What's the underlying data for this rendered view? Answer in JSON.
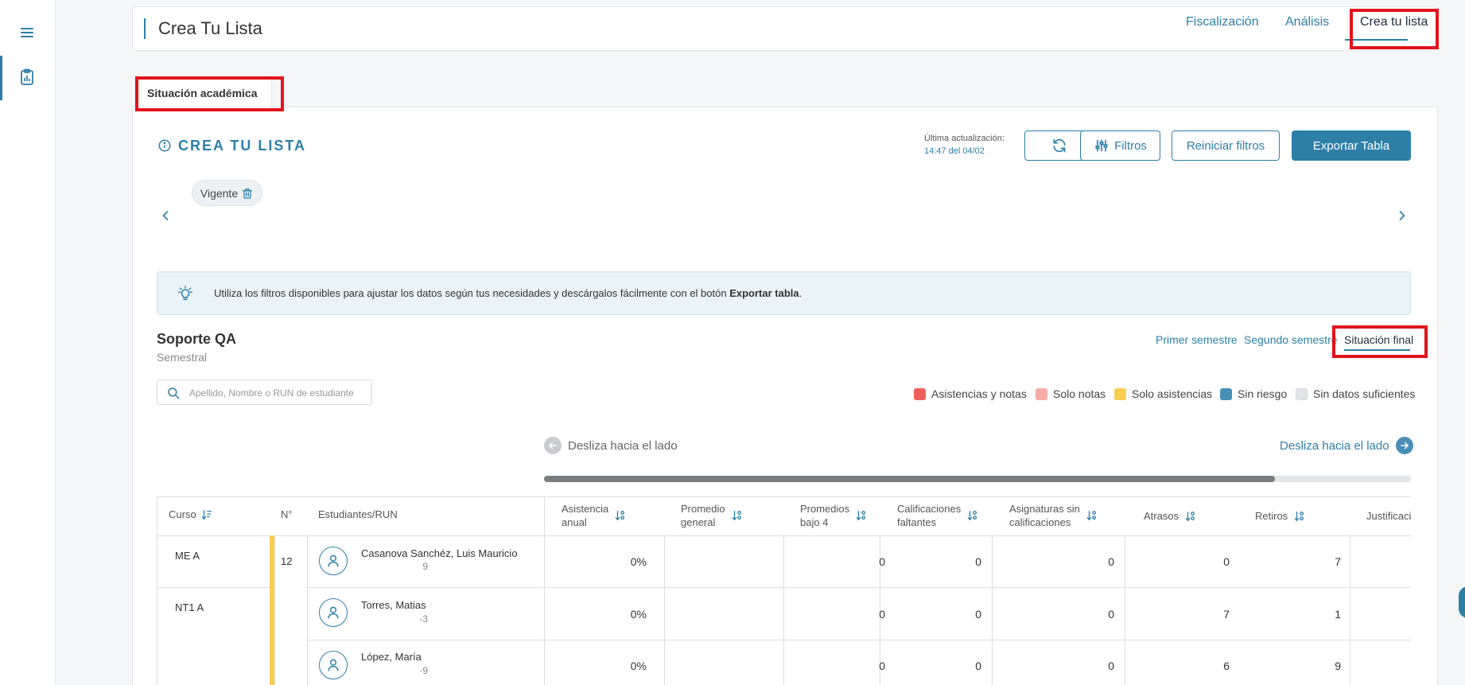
{
  "header": {
    "title": "Crea Tu Lista",
    "nav": [
      "Fiscalización",
      "Análisis",
      "Crea tu lista"
    ]
  },
  "tab": {
    "label": "Situación académica"
  },
  "section": {
    "title": "CREA TU LISTA",
    "update_label": "Última actualización:",
    "update_value": "14:47 del 04/02",
    "buttons": {
      "filters": "Filtros",
      "reset": "Reiniciar filtros",
      "export": "Exportar Tabla"
    }
  },
  "chip": {
    "label": "Vigente"
  },
  "tip": {
    "text": "Utiliza los filtros disponibles para ajustar los datos según tus necesidades y descárgalos fácilmente con el botón ",
    "bold": "Exportar tabla",
    "end": "."
  },
  "org": {
    "name": "Soporte QA",
    "period": "Semestral"
  },
  "period_tabs": [
    "Primer semestre",
    "Segundo semestre",
    "Situación final"
  ],
  "search": {
    "placeholder": "Apellido, Nombre o RUN de estudiante",
    "value": ""
  },
  "legend": [
    {
      "label": "Asistencias y notas",
      "color": "#ee5f5b"
    },
    {
      "label": "Solo notas",
      "color": "#f5aca6"
    },
    {
      "label": "Solo asistencias",
      "color": "#f9cd4f"
    },
    {
      "label": "Sin riesgo",
      "color": "#4a8fb5"
    },
    {
      "label": "Sin datos suficientes",
      "color": "#e1e5ea"
    }
  ],
  "slide": {
    "left": "Desliza hacia el lado",
    "right": "Desliza hacia el lado"
  },
  "table": {
    "fixed_headers": {
      "curso": "Curso",
      "num": "N°",
      "student": "Estudiantes/RUN"
    },
    "scroll_headers": [
      [
        "Asistencia",
        "anual"
      ],
      [
        "Promedio",
        "general"
      ],
      [
        "Promedios",
        "bajo 4"
      ],
      [
        "Calificaciones",
        "faltantes"
      ],
      [
        "Asignaturas sin",
        "calificaciones"
      ],
      [
        "Atrasos"
      ],
      [
        "Retiros"
      ],
      [
        "Justificaciones"
      ]
    ],
    "rows": [
      {
        "curso": "ME A",
        "num": "12",
        "name": "Casanova Sanchéz, Luis Mauricio",
        "run": "9",
        "asistencia": "0%",
        "promedio": "",
        "bajo4": "0",
        "faltantes": "0",
        "sin_calif": "0",
        "atrasos": "0",
        "retiros": "7"
      },
      {
        "curso": "NT1 A",
        "num": "",
        "name": "Torres, Matias",
        "run": "-3",
        "asistencia": "0%",
        "promedio": "",
        "bajo4": "0",
        "faltantes": "0",
        "sin_calif": "0",
        "atrasos": "7",
        "retiros": "1"
      },
      {
        "curso": "",
        "num": "",
        "name": "López, María",
        "run": "·9",
        "asistencia": "0%",
        "promedio": "",
        "bajo4": "0",
        "faltantes": "0",
        "sin_calif": "0",
        "atrasos": "6",
        "retiros": "9"
      }
    ]
  },
  "colors": {
    "accent": "#2e7fa8",
    "highlight": "#e0141c",
    "at_risk_bar": "#f9cd4f"
  },
  "icons": [
    "hamburger-menu-icon",
    "clipboard-chart-icon",
    "info-icon",
    "refresh-icon",
    "sliders-icon",
    "trash-icon",
    "chevron-left-icon",
    "chevron-right-icon",
    "lightbulb-icon",
    "search-icon",
    "arrow-left-circle-icon",
    "arrow-right-circle-icon",
    "sort-icon",
    "user-icon"
  ]
}
